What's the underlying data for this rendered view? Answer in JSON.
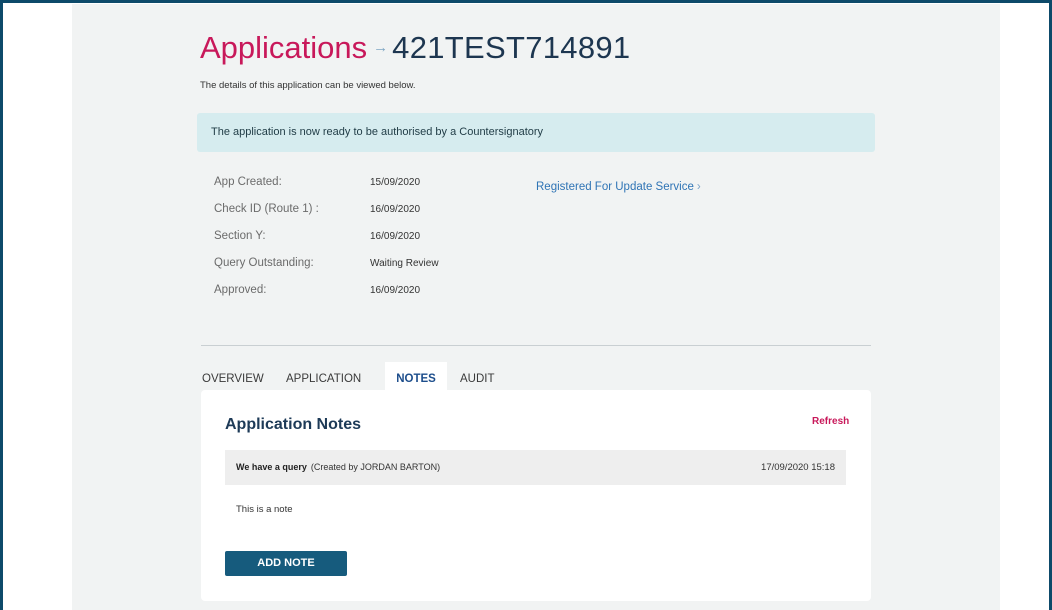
{
  "header": {
    "title": "Applications",
    "arrow": "→",
    "application_id": "421TEST714891",
    "subtitle": "The details of this application can be viewed below."
  },
  "alert": {
    "message": "The application is now ready to be authorised by a Countersignatory"
  },
  "details": [
    {
      "label": "App Created:",
      "value": "15/09/2020"
    },
    {
      "label": "Check ID (Route 1) :",
      "value": "16/09/2020"
    },
    {
      "label": "Section Y:",
      "value": "16/09/2020"
    },
    {
      "label": "Query Outstanding:",
      "value": "Waiting Review"
    },
    {
      "label": "Approved:",
      "value": "16/09/2020"
    }
  ],
  "update_service": {
    "label": "Registered For Update Service",
    "chevron": "›"
  },
  "tabs": [
    {
      "label": "OVERVIEW",
      "active": false
    },
    {
      "label": "APPLICATION",
      "active": false
    },
    {
      "label": "NOTES",
      "active": true
    },
    {
      "label": "AUDIT",
      "active": false
    }
  ],
  "notes_panel": {
    "title": "Application Notes",
    "refresh_label": "Refresh",
    "notes": [
      {
        "subject": "We have a query",
        "created_by": "(Created by JORDAN BARTON)",
        "timestamp": "17/09/2020 15:18",
        "body": "This is a note"
      }
    ],
    "add_note_label": "ADD NOTE"
  },
  "colors": {
    "brand_pink": "#c8185a",
    "navy": "#1d3650",
    "alert_bg": "#d6ecef",
    "link_blue": "#2f74b5",
    "button_bg": "#165b7d",
    "frame_border": "#0d4a6a"
  }
}
